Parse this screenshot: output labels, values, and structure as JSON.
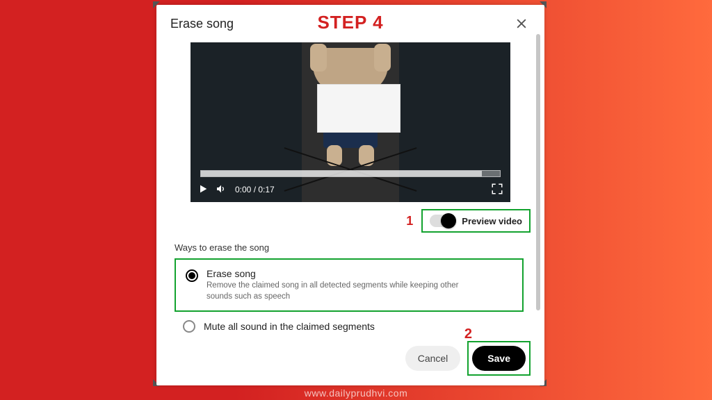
{
  "annotation": {
    "step_label": "STEP 4",
    "callout_1": "1",
    "callout_2": "2",
    "watermark": "www.dailyprudhvi.com"
  },
  "dialog": {
    "title": "Erase song",
    "video": {
      "time_display": "0:00 / 0:17"
    },
    "preview": {
      "label": "Preview video",
      "enabled": true
    },
    "section_label": "Ways to erase the song",
    "options": [
      {
        "title": "Erase song",
        "description": "Remove the claimed song in all detected segments while keeping other sounds such as speech",
        "selected": true
      },
      {
        "title": "Mute all sound in the claimed segments",
        "selected": false
      }
    ],
    "buttons": {
      "cancel": "Cancel",
      "save": "Save"
    }
  }
}
